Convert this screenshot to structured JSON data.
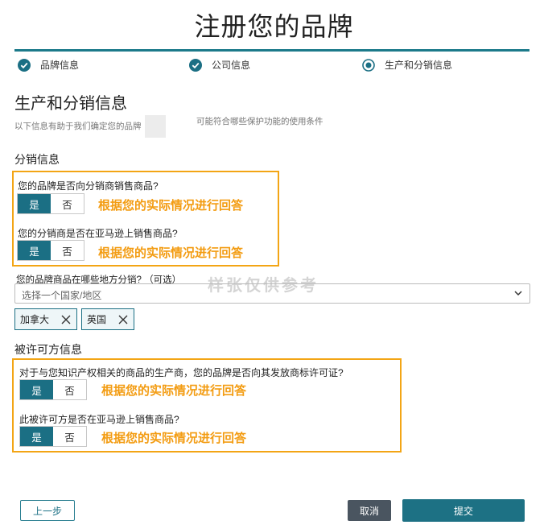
{
  "page_title": "注册您的品牌",
  "steps": [
    {
      "label": "品牌信息",
      "state": "complete"
    },
    {
      "label": "公司信息",
      "state": "complete"
    },
    {
      "label": "生产和分销信息",
      "state": "current"
    }
  ],
  "section": {
    "title": "生产和分销信息",
    "subtitle_part1": "以下信息有助于我们确定您的品牌",
    "subtitle_part2": "可能符合哪些保护功能的使用条件"
  },
  "distribution": {
    "heading": "分销信息",
    "q1": "您的品牌是否向分销商销售商品?",
    "q2": "您的分销商是否在亚马逊上销售商品?",
    "regions_label": "您的品牌商品在哪些地方分销? （可选）",
    "regions_placeholder": "选择一个国家/地区",
    "selected_regions": [
      "加拿大",
      "英国"
    ]
  },
  "licensee": {
    "heading": "被许可方信息",
    "q1": "对于与您知识产权相关的商品的生产商，您的品牌是否向其发放商标许可证?",
    "q2": "此被许可方是否在亚马逊上销售商品?"
  },
  "yes_label": "是",
  "no_label": "否",
  "hint": "根据您的实际情况进行回答",
  "watermark": "样张仅供参考",
  "buttons": {
    "prev": "上一步",
    "cancel": "取消",
    "submit": "提交"
  },
  "colors": {
    "accent": "#1b6f84",
    "highlight": "#f3a515",
    "hint": "#f39c12"
  }
}
